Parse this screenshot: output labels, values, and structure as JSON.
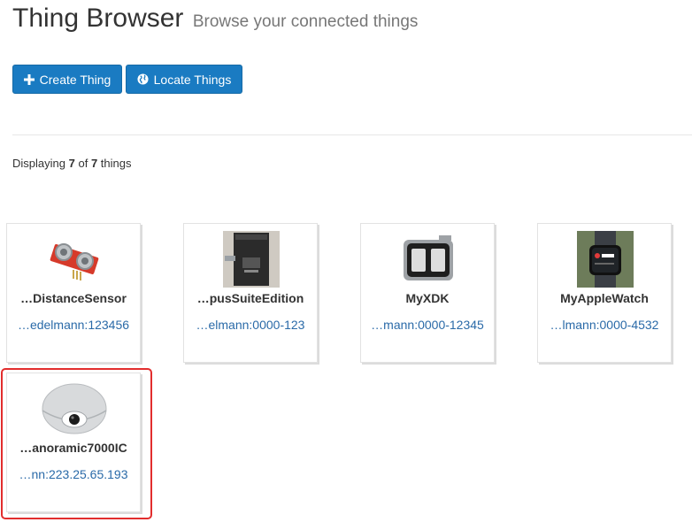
{
  "header": {
    "title": "Thing Browser",
    "subtitle": "Browse your connected things"
  },
  "toolbar": {
    "create_label": "Create Thing",
    "locate_label": "Locate Things"
  },
  "summary": {
    "prefix": "Displaying",
    "shown": "7",
    "of": "of",
    "total": "7",
    "suffix": "things"
  },
  "things": [
    {
      "name": "…DistanceSensor",
      "id": "…edelmann:123456"
    },
    {
      "name": "…pusSuiteEdition",
      "id": "…elmann:0000-123"
    },
    {
      "name": "MyXDK",
      "id": "…mann:0000-12345"
    },
    {
      "name": "MyAppleWatch",
      "id": "…lmann:0000-4532"
    },
    {
      "name": "…anoramic7000IC",
      "id": "…nn:223.25.65.193",
      "selected": true
    }
  ],
  "colors": {
    "primary": "#1a7bc2",
    "link": "#2a6aa8",
    "selection": "#e22d2d"
  }
}
